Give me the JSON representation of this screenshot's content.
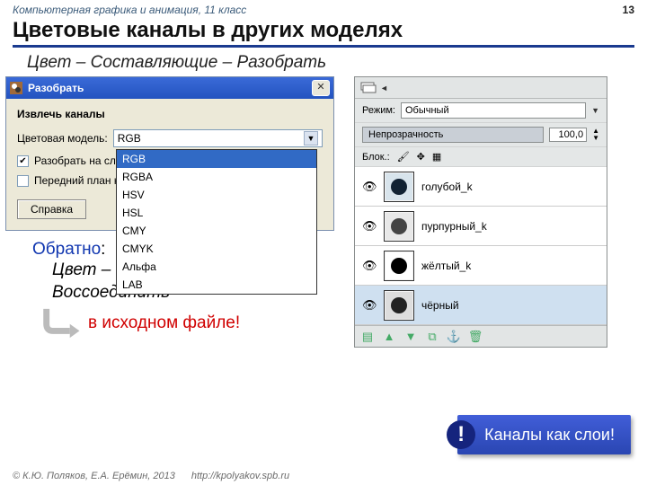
{
  "header": {
    "course": "Компьютерная графика и анимация, 11 класс",
    "page": "13",
    "title": "Цветовые каналы в других моделях"
  },
  "menu_path": "Цвет – Составляющие – Разобрать",
  "dialog": {
    "title": "Разобрать",
    "section": "Извлечь каналы",
    "model_label": "Цветовая модель:",
    "model_value": "RGB",
    "options": [
      "RGB",
      "RGBA",
      "HSV",
      "HSL",
      "CMY",
      "CMYK",
      "Альфа",
      "LAB"
    ],
    "check1": "Разобрать на слои",
    "check1_checked": true,
    "check2": "Передний план как",
    "check2_checked": false,
    "help_btn": "Справка"
  },
  "panel": {
    "mode_label": "Режим:",
    "mode_value": "Обычный",
    "opacity_label": "Непрозрачность",
    "opacity_value": "100,0",
    "lock_label": "Блок.:",
    "layers": [
      {
        "name": "голубой_k",
        "sel": false,
        "fill": "#cde",
        "dot": "#006"
      },
      {
        "name": "пурпурный_k",
        "sel": false,
        "fill": "#ddd",
        "dot": "#333"
      },
      {
        "name": "жёлтый_k",
        "sel": false,
        "fill": "#fff",
        "dot": "#000"
      },
      {
        "name": "чёрный",
        "sel": true,
        "fill": "#ddd",
        "dot": "#222"
      }
    ]
  },
  "back": {
    "label": "Обратно",
    "colon": ":",
    "path_l1": "Цвет – Составляющие –",
    "path_l2": "Воссоединить"
  },
  "note_red": "в исходном файле!",
  "callout_text": "Каналы как слои!",
  "footer": {
    "copyright": "© К.Ю. Поляков, Е.А. Ерёмин, 2013",
    "url": "http://kpolyakov.spb.ru"
  }
}
